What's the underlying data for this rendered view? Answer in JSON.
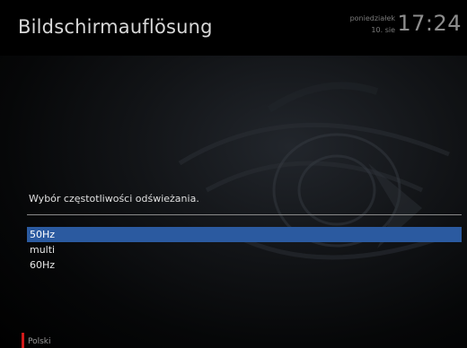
{
  "header": {
    "title": "Bildschirmauflösung",
    "weekday": "poniedziałek",
    "date": "10. sie",
    "time": "17:24"
  },
  "dialog": {
    "prompt": "Wybór częstotliwości odświeżania.",
    "options": [
      {
        "label": "50Hz",
        "selected": true
      },
      {
        "label": "multi",
        "selected": false
      },
      {
        "label": "60Hz",
        "selected": false
      }
    ]
  },
  "footer": {
    "language_label": "Polski",
    "language_marker_color": "#d11a1a"
  },
  "colors": {
    "selection": "#2b5aa0",
    "background": "#000000",
    "text": "#e6e6e6"
  }
}
